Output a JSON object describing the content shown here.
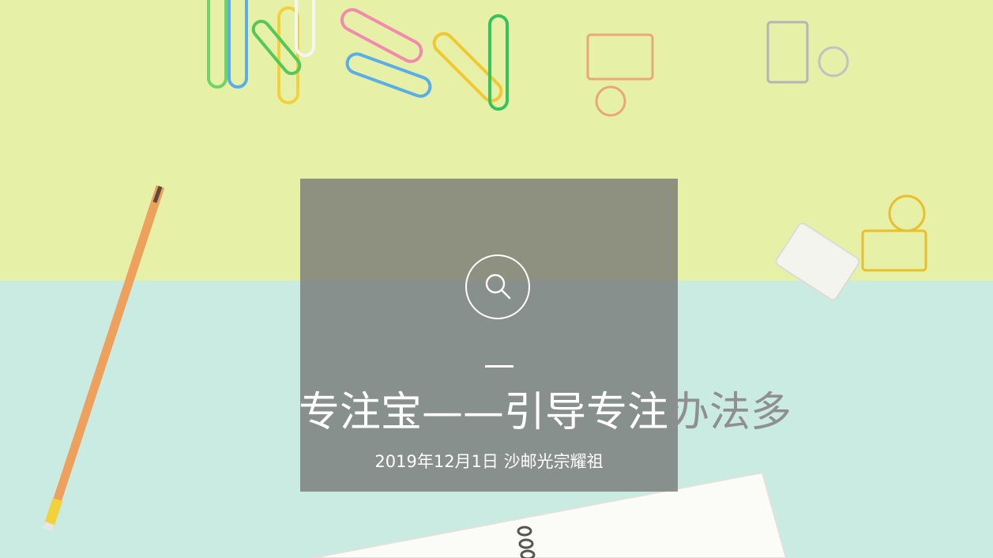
{
  "slide": {
    "title_part_white": "专注宝——引导专注",
    "title_part_gray": "办法多",
    "subtitle": "2019年12月1日 沙邮光宗耀祖"
  },
  "colors": {
    "top_background": "#e6f0a6",
    "bottom_background": "#c9ebe1",
    "card_overlay": "#767676",
    "title_white": "#ffffff",
    "title_gray": "#8f8f8f"
  },
  "icons": {
    "center": "search-icon"
  }
}
